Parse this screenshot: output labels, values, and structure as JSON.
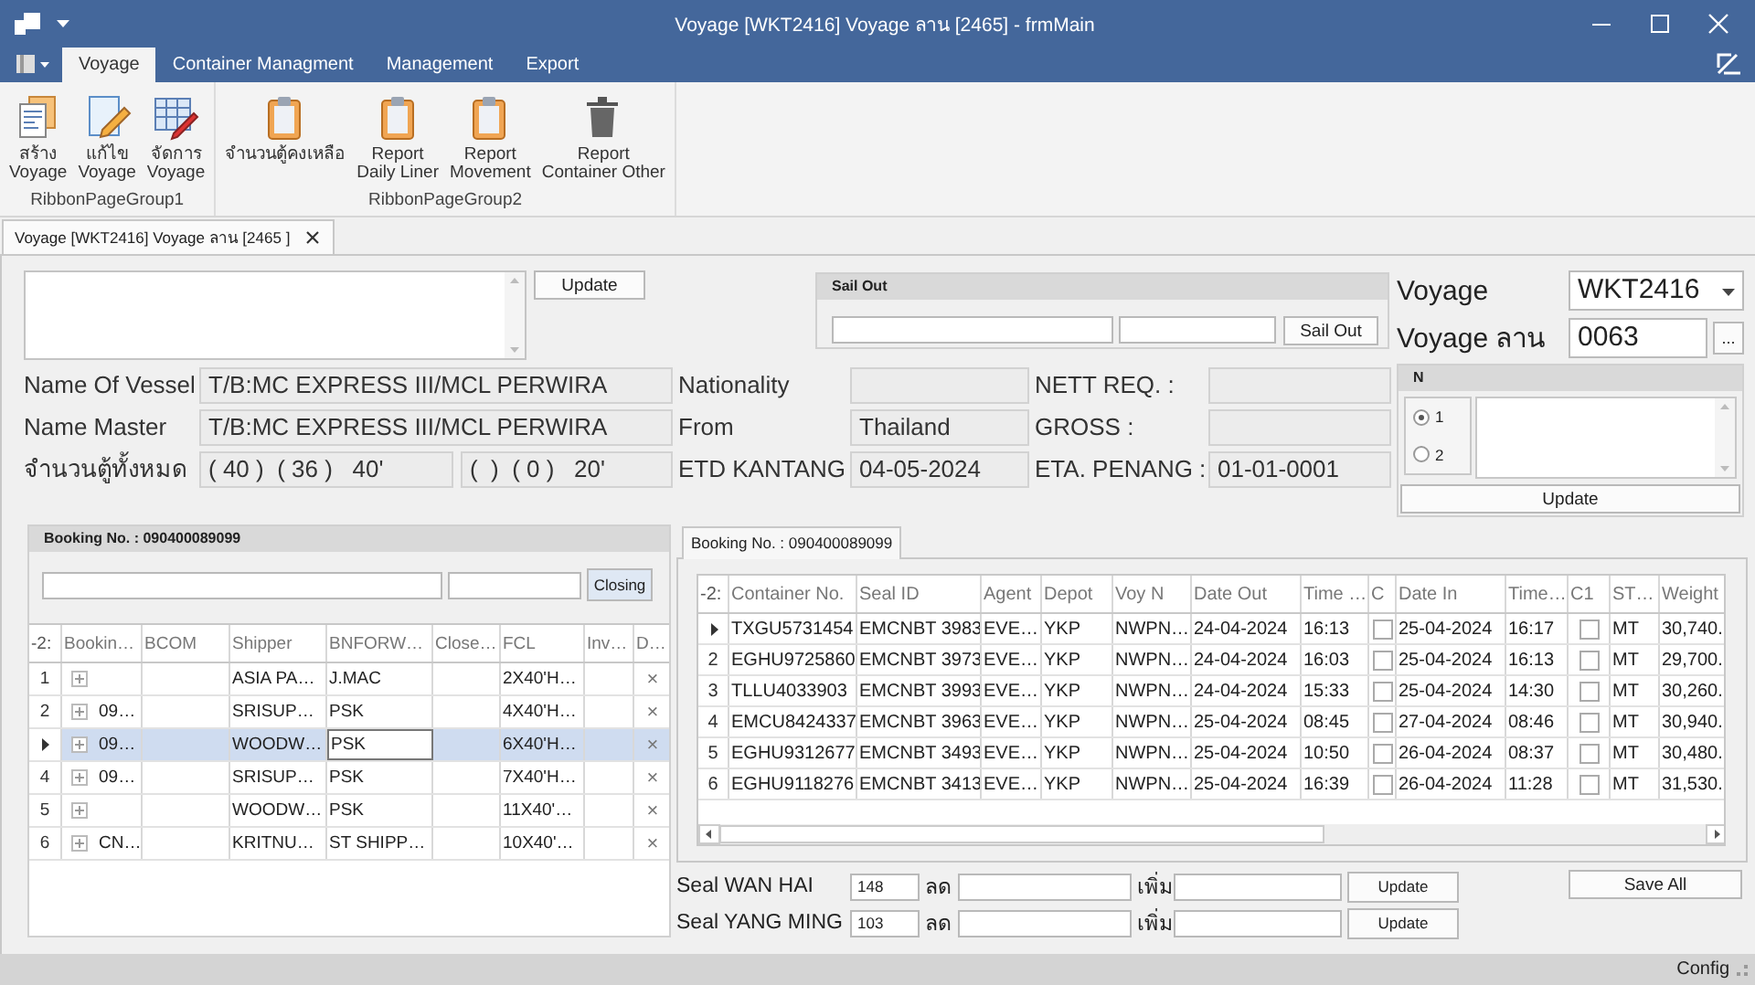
{
  "window": {
    "title": "Voyage [WKT2416] Voyage ลาน [2465] - frmMain"
  },
  "ribbon": {
    "tabs": [
      {
        "label": "Voyage",
        "selected": true
      },
      {
        "label": "Container Managment",
        "selected": false
      },
      {
        "label": "Management",
        "selected": false
      },
      {
        "label": "Export",
        "selected": false
      }
    ],
    "groups": [
      {
        "caption": "RibbonPageGroup1",
        "buttons": [
          {
            "label": "สร้าง\nVoyage",
            "kind": "documents"
          },
          {
            "label": "แก้ไข\nVoyage",
            "kind": "edit"
          },
          {
            "label": "จัดการ\nVoyage",
            "kind": "table"
          }
        ]
      },
      {
        "caption": "RibbonPageGroup2",
        "buttons": [
          {
            "label": "จำนวนตู้คงเหลือ",
            "kind": "clipboard"
          },
          {
            "label": "Report\nDaily Liner",
            "kind": "clipboard"
          },
          {
            "label": "Report\nMovement",
            "kind": "clipboard"
          },
          {
            "label": "Report\nContainer Other",
            "kind": "trash"
          }
        ]
      }
    ]
  },
  "document_tab": {
    "label": "Voyage [WKT2416] Voyage ลาน [2465 ]"
  },
  "note": {
    "button": "Update"
  },
  "sail_out": {
    "title": "Sail Out",
    "button": "Sail Out"
  },
  "vessel_info": [
    [
      {
        "label": "Name Of Vessel",
        "values": [
          "T/B:MC EXPRESS III/MCL PERWIRA"
        ]
      },
      {
        "label": "Nationality"
      },
      {
        "label": "NETT REQ. :"
      }
    ],
    [
      {
        "label": "Name Master",
        "values": [
          "T/B:MC EXPRESS III/MCL PERWIRA"
        ]
      },
      {
        "label": "From",
        "values": [
          "Thailand"
        ]
      },
      {
        "label": "GROSS :"
      }
    ],
    [
      {
        "label": "จำนวนตู้ทั้งหมด",
        "values": [
          "( 40 )  ( 36 )   40'",
          "(  )  ( 0 )   20'"
        ]
      },
      {
        "label": "ETD KANTANG",
        "values": [
          "04-05-2024"
        ]
      },
      {
        "label": "ETA. PENANG :",
        "values": [
          "01-01-0001"
        ]
      }
    ]
  ],
  "voyage": {
    "label": "Voyage",
    "value": "WKT2416"
  },
  "voyage_yard": {
    "label": "Voyage ลาน",
    "value": "0063",
    "button": "..."
  },
  "n_panel": {
    "title": "N",
    "options": [
      {
        "label": "1",
        "selected": true
      },
      {
        "label": "2",
        "selected": false
      }
    ],
    "button": "Update"
  },
  "booking_panel": {
    "title": "Booking No. : 090400089099",
    "button": "Closing",
    "grid": {
      "corner": "-2:",
      "columns": [
        {
          "title": "Bookin…",
          "kind": "expand"
        },
        {
          "title": "BCOM",
          "kind": "text"
        },
        {
          "title": "Shipper",
          "kind": "text"
        },
        {
          "title": "BNFORW…",
          "kind": "text"
        },
        {
          "title": "Close…",
          "kind": "text"
        },
        {
          "title": "FCL",
          "kind": "text"
        },
        {
          "title": "Inv…",
          "kind": "text"
        },
        {
          "title": "D…",
          "kind": "delete"
        }
      ],
      "rows": [
        {
          "number": "1",
          "selected": false,
          "current": false,
          "cells": [
            null,
            null,
            "ASIA PA…",
            "J.MAC",
            null,
            "2X40'H…",
            null,
            "×"
          ]
        },
        {
          "number": "2",
          "selected": false,
          "current": false,
          "cells": [
            "09…",
            null,
            "SRISUP…",
            "PSK",
            null,
            "4X40'H…",
            null,
            "×"
          ]
        },
        {
          "selected": true,
          "current": true,
          "cells": [
            "09…",
            null,
            "WOODW…",
            {
              "text": "PSK",
              "focused": true
            },
            null,
            "6X40'H…",
            null,
            "×"
          ]
        },
        {
          "number": "4",
          "selected": false,
          "current": false,
          "cells": [
            "09…",
            null,
            "SRISUP…",
            "PSK",
            null,
            "7X40'H…",
            null,
            "×"
          ]
        },
        {
          "number": "5",
          "selected": false,
          "current": false,
          "cells": [
            null,
            null,
            "WOODW…",
            "PSK",
            null,
            "11X40'…",
            null,
            "×"
          ]
        },
        {
          "number": "6",
          "selected": false,
          "current": false,
          "cells": [
            "CN…",
            null,
            "KRITNU…",
            "ST SHIPP…",
            null,
            "10X40'…",
            null,
            "×"
          ]
        }
      ]
    }
  },
  "container_panel": {
    "tab": "Booking No. : 090400089099",
    "grid": {
      "corner": "-2:",
      "columns": [
        {
          "title": "Container No.",
          "kind": "text"
        },
        {
          "title": "Seal ID",
          "kind": "text"
        },
        {
          "title": "Agent",
          "kind": "text"
        },
        {
          "title": "Depot",
          "kind": "text"
        },
        {
          "title": "Voy N",
          "kind": "text"
        },
        {
          "title": "Date Out",
          "kind": "text"
        },
        {
          "title": "Time …",
          "kind": "text"
        },
        {
          "title": "C",
          "kind": "check"
        },
        {
          "title": "Date In",
          "kind": "text"
        },
        {
          "title": "Time…",
          "kind": "text"
        },
        {
          "title": "C1",
          "kind": "check"
        },
        {
          "title": "ST…",
          "kind": "text"
        },
        {
          "title": "Weight",
          "kind": "text"
        }
      ],
      "rows": [
        {
          "current": true,
          "cells": [
            "TXGU5731454",
            "EMCNBT 3983",
            "EVE…",
            "YKP",
            "NWPN…",
            "24-04-2024",
            "16:13",
            false,
            "25-04-2024",
            "16:17",
            false,
            "MT",
            "30,740."
          ]
        },
        {
          "number": "2",
          "current": false,
          "cells": [
            "EGHU9725860",
            "EMCNBT 3973",
            "EVE…",
            "YKP",
            "NWPN…",
            "24-04-2024",
            "16:03",
            false,
            "25-04-2024",
            "16:13",
            false,
            "MT",
            "29,700."
          ]
        },
        {
          "number": "3",
          "current": false,
          "cells": [
            "TLLU4033903",
            "EMCNBT 3993",
            "EVE…",
            "YKP",
            "NWPN…",
            "24-04-2024",
            "15:33",
            false,
            "25-04-2024",
            "14:30",
            false,
            "MT",
            "30,260."
          ]
        },
        {
          "number": "4",
          "current": false,
          "cells": [
            "EMCU8424337",
            "EMCNBT 3963",
            "EVE…",
            "YKP",
            "NWPN…",
            "25-04-2024",
            "08:45",
            false,
            "27-04-2024",
            "08:46",
            false,
            "MT",
            "30,940."
          ]
        },
        {
          "number": "5",
          "current": false,
          "cells": [
            "EGHU9312677",
            "EMCNBT 3493",
            "EVE…",
            "YKP",
            "NWPN…",
            "25-04-2024",
            "10:50",
            false,
            "26-04-2024",
            "08:37",
            false,
            "MT",
            "30,480."
          ]
        },
        {
          "number": "6",
          "current": false,
          "cells": [
            "EGHU9118276",
            "EMCNBT 3413",
            "EVE…",
            "YKP",
            "NWPN…",
            "25-04-2024",
            "16:39",
            false,
            "26-04-2024",
            "11:28",
            false,
            "MT",
            "31,530."
          ]
        }
      ]
    }
  },
  "seals": [
    {
      "label": "Seal WAN HAI",
      "count": "148",
      "minus_label": "ลด",
      "plus_label": "เพิ่ม",
      "button": "Update"
    },
    {
      "label": "Seal YANG MING",
      "count": "103",
      "minus_label": "ลด",
      "plus_label": "เพิ่ม",
      "button": "Update"
    }
  ],
  "save_all": "Save All",
  "status_bar": {
    "text": "Config"
  }
}
